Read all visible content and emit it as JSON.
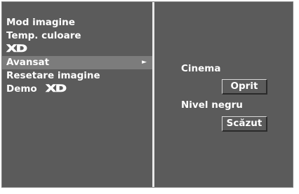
{
  "menu": {
    "items": [
      {
        "label": "Mod imagine"
      },
      {
        "label": "Temp. culoare"
      },
      {
        "label": "XD"
      },
      {
        "label": "Avansat",
        "arrow": "►"
      },
      {
        "label": "Resetare imagine"
      },
      {
        "label": "Demo",
        "logo": "XD"
      }
    ],
    "active_index": 3
  },
  "submenu": {
    "cinema": {
      "label": "Cinema",
      "value": "Oprit"
    },
    "black_level": {
      "label": "Nivel negru",
      "value": "Scăzut"
    }
  },
  "colors": {
    "panel_bg": "#5b5b5b",
    "highlight_bg": "#7c7c7c",
    "divider": "#e8e8e8",
    "text": "#ffffff"
  }
}
